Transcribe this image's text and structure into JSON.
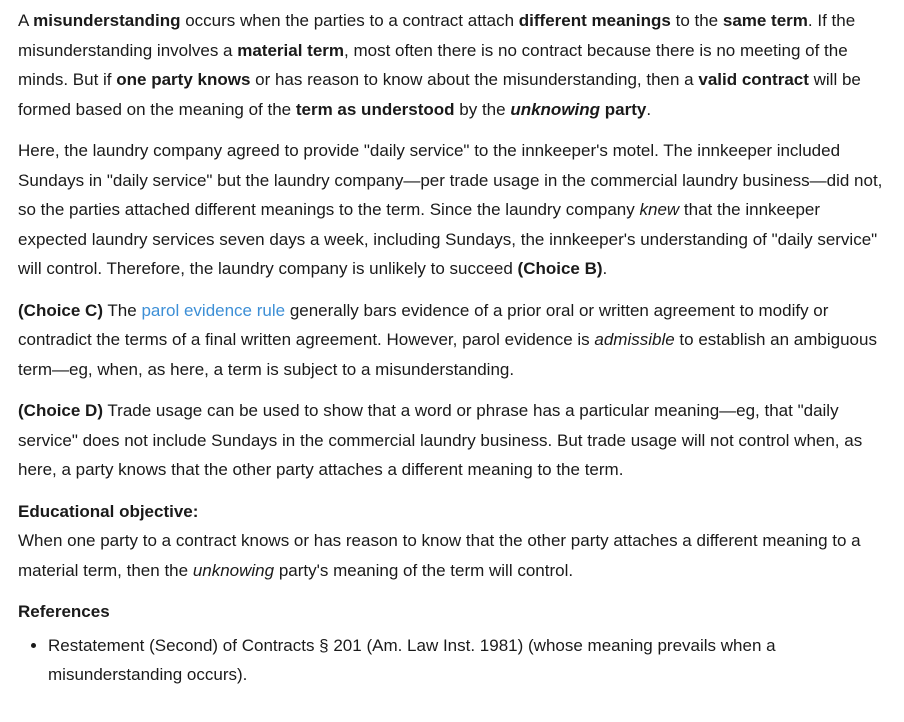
{
  "explanation": {
    "p1": [
      {
        "text": "A "
      },
      {
        "text": "misunderstanding",
        "bold": true
      },
      {
        "text": " occurs when the parties to a contract attach "
      },
      {
        "text": "different meanings",
        "bold": true
      },
      {
        "text": " to the "
      },
      {
        "text": "same term",
        "bold": true
      },
      {
        "text": ".  If the misunderstanding involves a "
      },
      {
        "text": "material term",
        "bold": true
      },
      {
        "text": ", most often there is no contract because there is no meeting of the minds.  But if "
      },
      {
        "text": "one party knows",
        "bold": true
      },
      {
        "text": " or has reason to know about the misunderstanding, then a "
      },
      {
        "text": "valid contract",
        "bold": true
      },
      {
        "text": " will be formed based on the meaning of the "
      },
      {
        "text": "term as understood",
        "bold": true
      },
      {
        "text": " by the "
      },
      {
        "text": "unknowing",
        "bold": true,
        "italic": true
      },
      {
        "text": " party",
        "bold": true
      },
      {
        "text": "."
      }
    ],
    "p2": [
      {
        "text": "Here, the laundry company agreed to provide \"daily service\" to the innkeeper's motel.  The innkeeper included Sundays in \"daily service\" but the laundry company—per trade usage in the commercial laundry business—did not, so the parties attached different meanings to the term.  Since the laundry company "
      },
      {
        "text": "knew",
        "italic": true
      },
      {
        "text": " that the innkeeper expected laundry services seven days a week, including Sundays, the innkeeper's understanding of \"daily service\" will control.  Therefore, the laundry company is unlikely to succeed "
      },
      {
        "text": "(Choice B)",
        "bold": true
      },
      {
        "text": "."
      }
    ],
    "p3": [
      {
        "text": "(Choice C)",
        "bold": true
      },
      {
        "text": "  The "
      },
      {
        "text": "parol evidence rule",
        "link": true
      },
      {
        "text": " generally bars evidence of a prior oral or written agreement to modify or contradict the terms of a final written agreement.  However, parol evidence is "
      },
      {
        "text": "admissible",
        "italic": true
      },
      {
        "text": " to establish an ambiguous term—eg, when, as here, a term is subject to a misunderstanding."
      }
    ],
    "p4": [
      {
        "text": "(Choice D)",
        "bold": true
      },
      {
        "text": "  Trade usage can be used to show that a word or phrase has a particular meaning—eg, that \"daily service\" does not include Sundays in the commercial laundry business.  But trade usage will not control when, as here, a party knows that the other party attaches a different meaning to the term."
      }
    ]
  },
  "objective": {
    "heading": "Educational objective:",
    "body": [
      {
        "text": "When one party to a contract knows or has reason to know that the other party attaches a different meaning to a material term, then the "
      },
      {
        "text": "unknowing",
        "italic": true
      },
      {
        "text": " party's meaning of the term will control."
      }
    ]
  },
  "references": {
    "heading": "References",
    "items": [
      "Restatement (Second) of Contracts § 201 (Am. Law Inst. 1981) (whose meaning prevails when a misunderstanding occurs)."
    ]
  },
  "colors": {
    "text": "#1a1a1a",
    "link": "#3d8fd6",
    "background": "#ffffff"
  }
}
